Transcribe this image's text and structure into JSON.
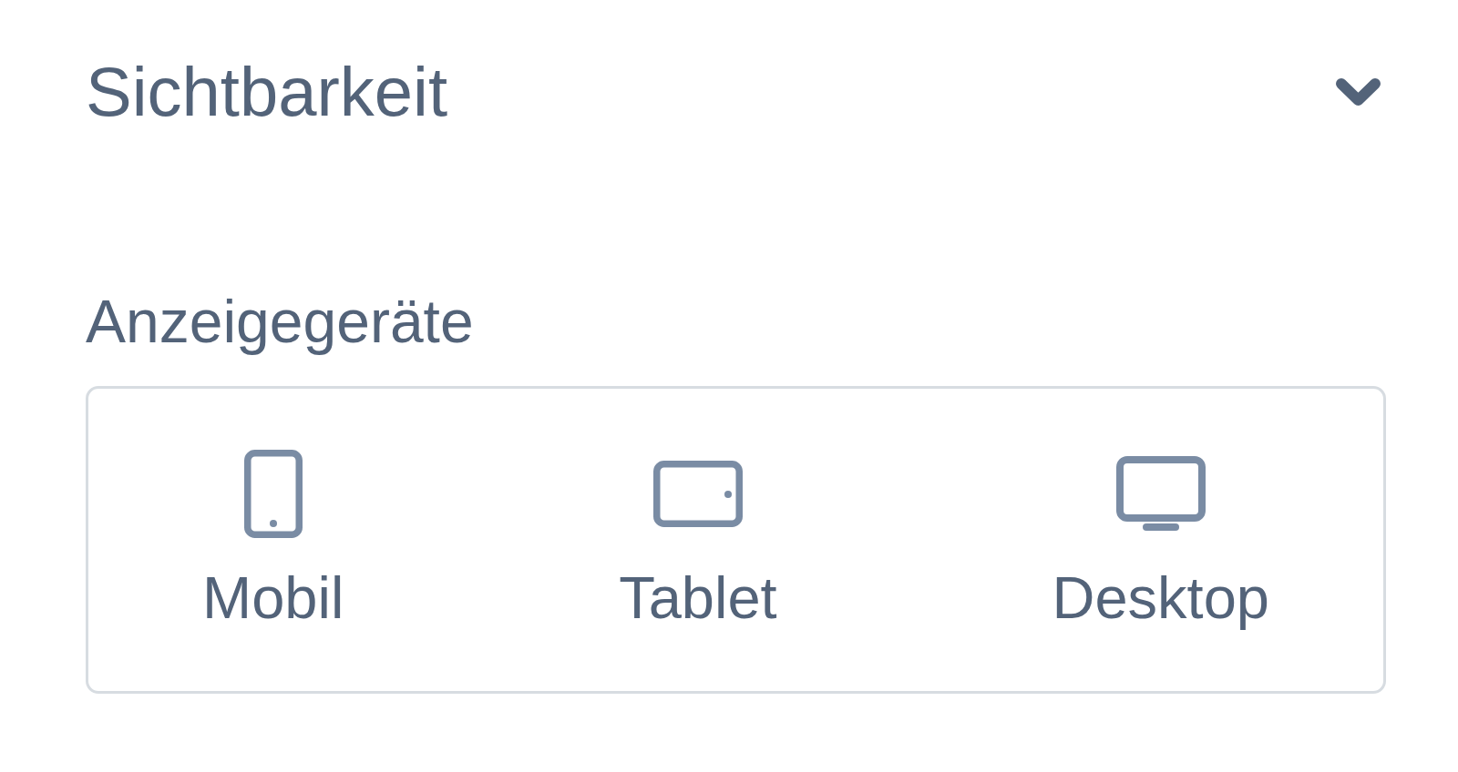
{
  "section": {
    "title": "Sichtbarkeit",
    "expanded": true
  },
  "devices_field": {
    "label": "Anzeigegeräte",
    "options": [
      {
        "kind": "mobile",
        "label": "Mobil"
      },
      {
        "kind": "tablet",
        "label": "Tablet"
      },
      {
        "kind": "desktop",
        "label": "Desktop"
      }
    ]
  }
}
